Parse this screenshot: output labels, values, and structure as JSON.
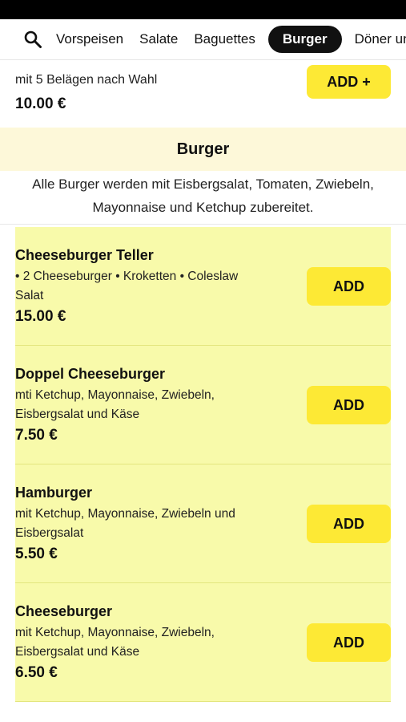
{
  "nav": {
    "search_icon": "search-icon",
    "tabs": [
      {
        "label": "Vorspeisen"
      },
      {
        "label": "Salate"
      },
      {
        "label": "Baguettes"
      },
      {
        "label": "Burger",
        "active": true
      },
      {
        "label": "Döner und"
      }
    ]
  },
  "previous_item": {
    "description": "mit 5 Belägen nach Wahl",
    "price": "10.00 €",
    "add_label": "ADD +"
  },
  "section": {
    "title": "Burger",
    "description": "Alle Burger werden mit Eisbergsalat, Tomaten, Zwiebeln, Mayonnaise und Ketchup zubereitet."
  },
  "items": [
    {
      "name": "Cheeseburger Teller",
      "description": "• 2 Cheeseburger • Kroketten • Coleslaw Salat",
      "price": "15.00 €",
      "add_label": "ADD"
    },
    {
      "name": "Doppel Cheeseburger",
      "description": "mti Ketchup, Mayonnaise, Zwiebeln, Eisbergsalat und Käse",
      "price": "7.50 €",
      "add_label": "ADD"
    },
    {
      "name": "Hamburger",
      "description": "mit Ketchup, Mayonnaise, Zwiebeln und Eisbergsalat",
      "price": "5.50 €",
      "add_label": "ADD"
    },
    {
      "name": "Cheeseburger",
      "description": "mit Ketchup, Mayonnaise, Zwiebeln, Eisbergsalat und Käse",
      "price": "6.50 €",
      "add_label": "ADD"
    }
  ],
  "colors": {
    "accent_button": "#fde935",
    "item_background": "#f8faaa",
    "section_header_background": "#fdf8d9",
    "active_tab": "#111111"
  }
}
